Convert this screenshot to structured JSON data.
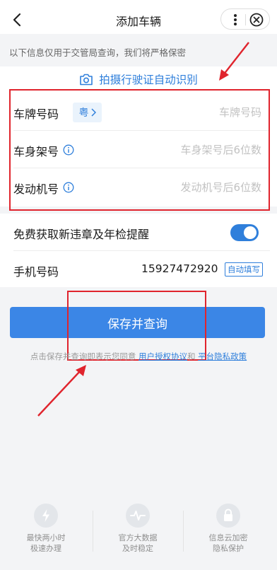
{
  "header": {
    "title": "添加车辆"
  },
  "notice": "以下信息仅用于交管局查询，我们将严格保密",
  "photo_recognize": "拍摄行驶证自动识别",
  "form": {
    "plate": {
      "label": "车牌号码",
      "province": "粤",
      "placeholder": "车牌号码"
    },
    "vin": {
      "label": "车身架号",
      "placeholder": "车身架号后6位数"
    },
    "engine": {
      "label": "发动机号",
      "placeholder": "发动机号后6位数"
    }
  },
  "options": {
    "reminder_label": "免费获取新违章及年检提醒",
    "reminder_on": true,
    "phone_label": "手机号码",
    "phone_value": "15927472920",
    "autofill_label": "自动填写"
  },
  "save_button": "保存并查询",
  "agreement": {
    "prefix": "点击保存并查询即表示您同意",
    "link1": "用户授权协议",
    "and": "和",
    "link2": "平台隐私政策"
  },
  "features": [
    {
      "icon": "lightning-icon",
      "line1": "最快两小时",
      "line2": "极速办理"
    },
    {
      "icon": "pulse-icon",
      "line1": "官方大数据",
      "line2": "及时稳定"
    },
    {
      "icon": "lock-icon",
      "line1": "信息云加密",
      "line2": "隐私保护"
    }
  ],
  "colors": {
    "accent": "#2f7fdb",
    "button": "#3b86e6",
    "annotation": "#e0242d"
  }
}
